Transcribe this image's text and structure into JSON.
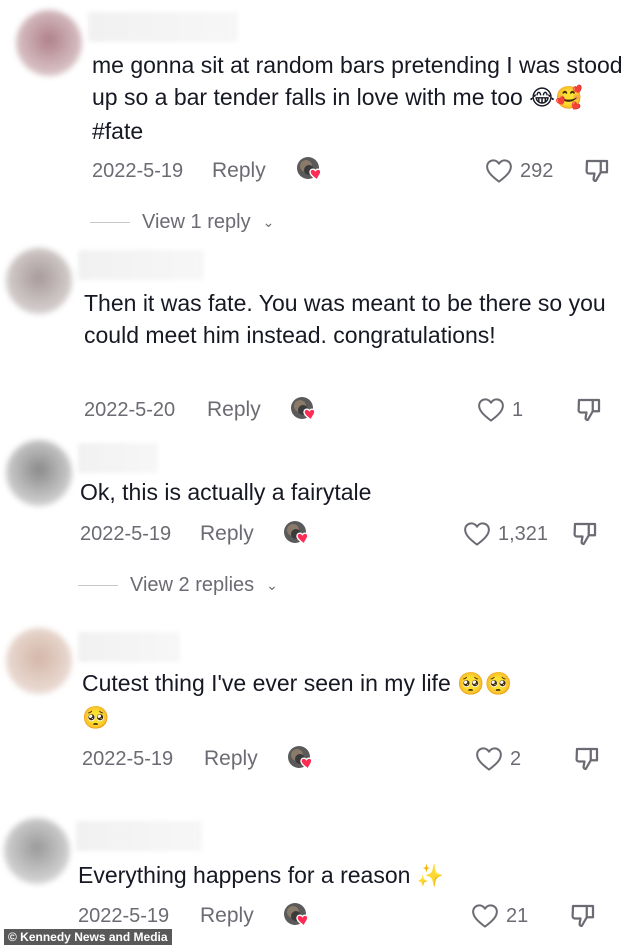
{
  "colors": {
    "heart_badge": "#fe2c55",
    "meta_text": "#6b6b73",
    "text": "#161823"
  },
  "comments": [
    {
      "text": "me gonna sit at random bars pretending I was stood up so a bar tender falls in love with me too",
      "emojis": "😂🥰",
      "hashtag": "#fate",
      "date": "2022-5-19",
      "reply_label": "Reply",
      "likes": "292",
      "view_replies": "View 1 reply"
    },
    {
      "text": "Then it was fate. You was meant to be there so you could meet him instead. congratulations!",
      "date": "2022-5-20",
      "reply_label": "Reply",
      "likes": "1"
    },
    {
      "text": "Ok, this is actually a fairytale",
      "date": "2022-5-19",
      "reply_label": "Reply",
      "likes": "1,321",
      "view_replies": "View 2 replies"
    },
    {
      "text": "Cutest thing I've ever seen in my life",
      "emojis": "🥺🥺",
      "emojis_line2": "🥺",
      "date": "2022-5-19",
      "reply_label": "Reply",
      "likes": "2"
    },
    {
      "text": "Everything happens for a reason",
      "emojis": "✨",
      "date": "2022-5-19",
      "reply_label": "Reply",
      "likes": "21"
    }
  ],
  "watermark": "© Kennedy News and Media"
}
